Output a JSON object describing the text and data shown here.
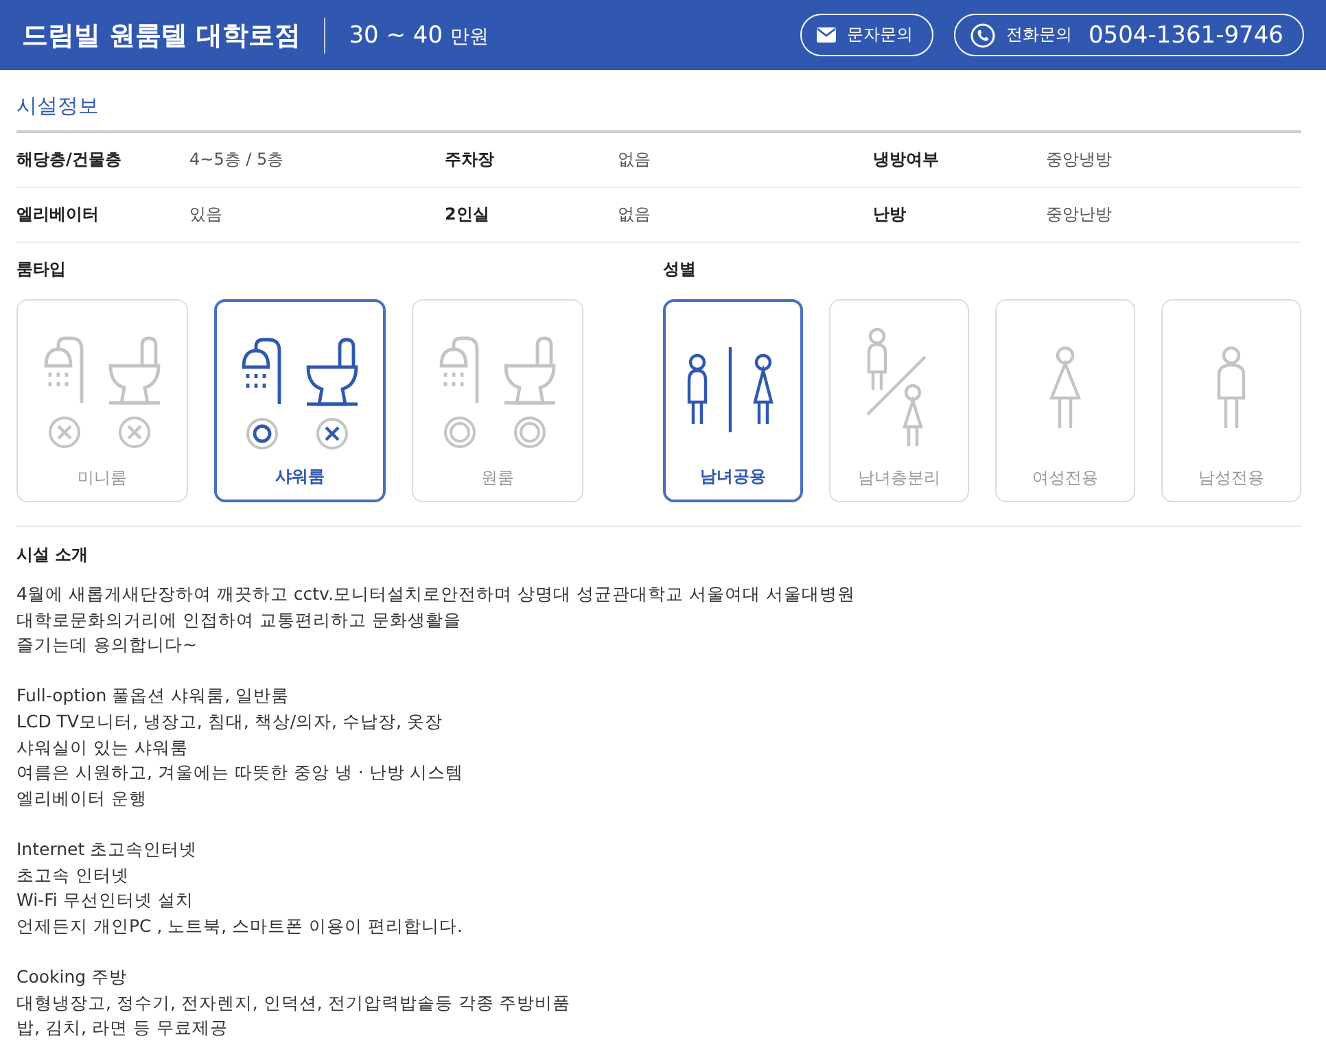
{
  "header": {
    "title": "드림빌 원룸텔 대학로점",
    "price": "30 ~ 40",
    "price_unit": "만원",
    "buttons": [
      {
        "kind": "sms",
        "label": "문자문의"
      },
      {
        "kind": "phone",
        "label": "전화문의",
        "number": "0504-1361-9746"
      }
    ]
  },
  "facility": {
    "title": "시설정보",
    "rows": [
      [
        {
          "label": "해당층/건물층",
          "value": "4~5층 / 5층"
        },
        {
          "label": "주차장",
          "value": "없음"
        },
        {
          "label": "냉방여부",
          "value": "중앙냉방"
        }
      ],
      [
        {
          "label": "엘리베이터",
          "value": "있음"
        },
        {
          "label": "2인실",
          "value": "없음"
        },
        {
          "label": "난방",
          "value": "중앙난방"
        }
      ]
    ]
  },
  "room_type": {
    "title": "룸타입",
    "options": [
      {
        "label": "미니룸",
        "selected": false,
        "fixtures": [
          {
            "kind": "shower",
            "mark": {
              "kind": "cross"
            }
          },
          {
            "kind": "toilet",
            "mark": {
              "kind": "cross"
            }
          }
        ]
      },
      {
        "label": "샤워룸",
        "selected": true,
        "fixtures": [
          {
            "kind": "shower",
            "mark": {
              "kind": "circle"
            }
          },
          {
            "kind": "toilet",
            "mark": {
              "kind": "cross"
            }
          }
        ]
      },
      {
        "label": "원룸",
        "selected": false,
        "fixtures": [
          {
            "kind": "shower",
            "mark": {
              "kind": "double_circle"
            }
          },
          {
            "kind": "toilet",
            "mark": {
              "kind": "double_circle"
            }
          }
        ]
      }
    ]
  },
  "gender": {
    "title": "성별",
    "options": [
      {
        "label": "남녀공용",
        "selected": true,
        "kind": "mixed"
      },
      {
        "label": "남녀층분리",
        "selected": false,
        "kind": "floor_split"
      },
      {
        "label": "여성전용",
        "selected": false,
        "kind": "female"
      },
      {
        "label": "남성전용",
        "selected": false,
        "kind": "male"
      }
    ]
  },
  "intro": {
    "title": "시설 소개",
    "paragraphs": [
      [
        "4월에 새롭게새단장하여 깨끗하고 cctv.모니터설치로안전하며 상명대 성균관대학교 서울여대 서울대병원",
        "대학로문화의거리에 인접하여 교통편리하고 문화생활을",
        "즐기는데 용의합니다~"
      ],
      [
        "Full-option 풀옵션 샤워룸, 일반룸",
        "LCD TV모니터, 냉장고, 침대, 책상/의자, 수납장, 옷장",
        "샤워실이 있는 샤워룸",
        "여름은 시원하고, 겨울에는 따뜻한 중앙 냉 · 난방 시스템",
        "엘리베이터 운행"
      ],
      [
        "Internet 초고속인터넷",
        "초고속 인터넷",
        "Wi-Fi 무선인터넷 설치",
        "언제든지 개인PC , 노트북, 스마트폰 이용이 편리합니다."
      ],
      [
        "Cooking 주방",
        "대형냉장고, 정수기, 전자렌지, 인덕션, 전기압력밥솥등 각종 주방비품",
        "밥, 김치, 라면 등 무료제공"
      ]
    ]
  }
}
